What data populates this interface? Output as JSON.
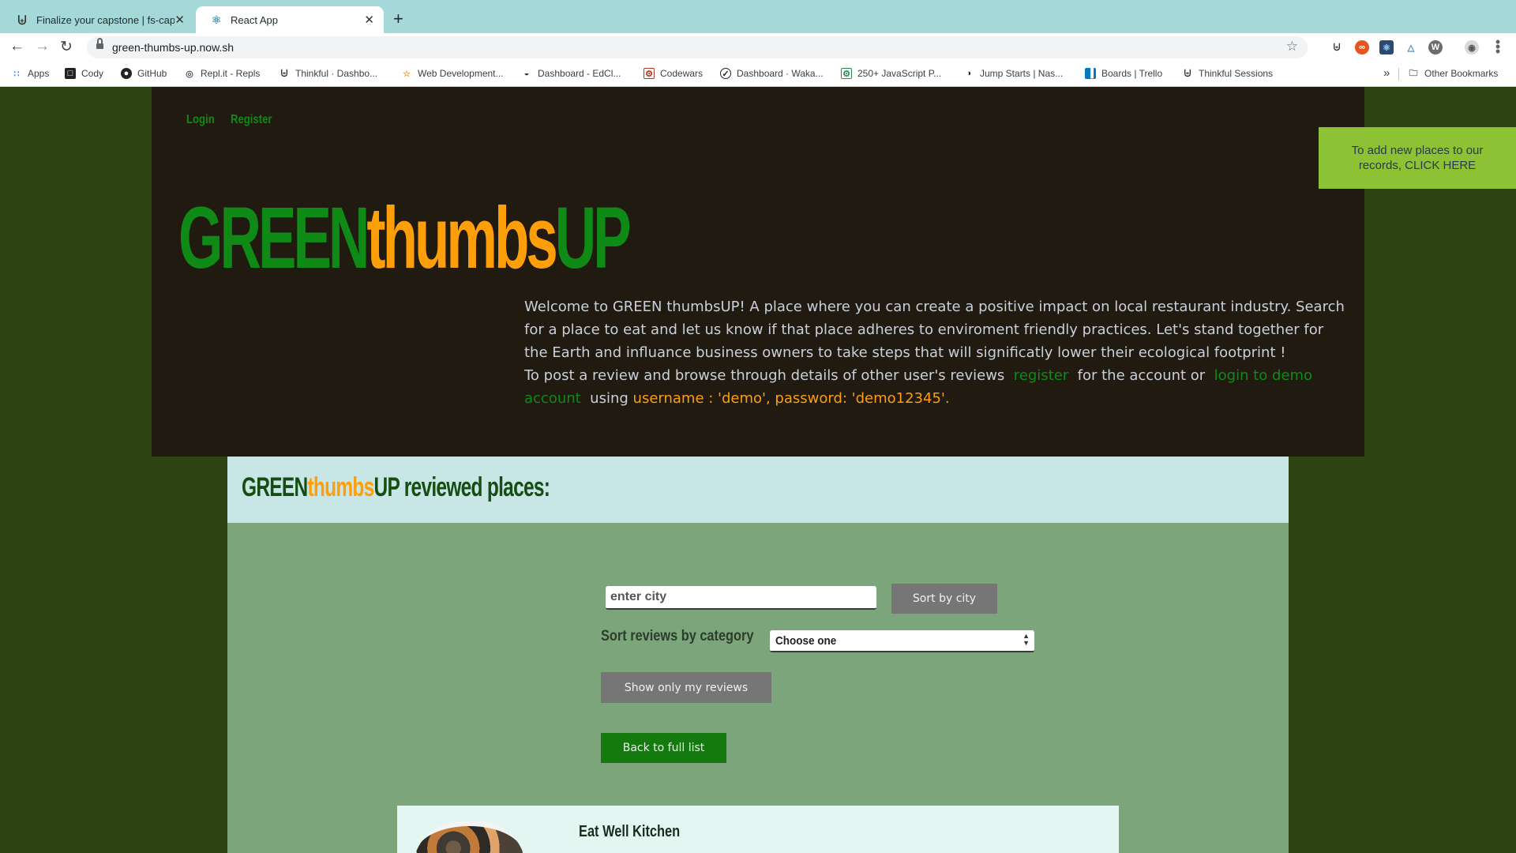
{
  "browser": {
    "tabs": [
      {
        "label": "Finalize your capstone | fs-capstone",
        "icon": "thinkful-icon",
        "active": false
      },
      {
        "label": "React App",
        "icon": "react-icon",
        "active": true
      }
    ],
    "url": "green-thumbs-up.now.sh",
    "bookmarks": [
      {
        "label": "Apps",
        "icon": "apps-grid-icon"
      },
      {
        "label": "Cody",
        "icon": "cody-icon"
      },
      {
        "label": "GitHub",
        "icon": "github-icon"
      },
      {
        "label": "Repl.it - Repls",
        "icon": "replit-icon"
      },
      {
        "label": "Thinkful · Dashbo...",
        "icon": "thinkful-icon"
      },
      {
        "label": "Web Development...",
        "icon": "web-dev-icon"
      },
      {
        "label": "Dashboard - EdCl...",
        "icon": "edclub-icon"
      },
      {
        "label": "Codewars",
        "icon": "codewars-icon"
      },
      {
        "label": "Dashboard · Waka...",
        "icon": "wakatime-icon"
      },
      {
        "label": "250+ JavaScript P...",
        "icon": "javascript-icon"
      },
      {
        "label": "Jump Starts | Nas...",
        "icon": "jumpstarts-icon"
      },
      {
        "label": "Boards | Trello",
        "icon": "trello-icon"
      },
      {
        "label": "Thinkful Sessions",
        "icon": "thinkful-icon"
      }
    ],
    "other_bookmarks": "Other Bookmarks"
  },
  "hero": {
    "nav": {
      "login": "Login",
      "register": "Register"
    },
    "brand": {
      "part1": "GREEN",
      "part2": "thumbs",
      "part3": "UP"
    },
    "welcome": "Welcome to GREEN thumbsUP! A place where you can create a positive impact on local restaurant industry. Search for a place to eat and let us know if that place adheres to enviroment friendly practices. Let's stand together for the Earth and influance business owners to take steps that will significatly lower their ecological footprint !",
    "post_prefix": "To post a review and browse through details of other user's reviews",
    "register_link": "register",
    "account_text": "for the account or",
    "login_demo_link": "login to demo account",
    "using_text": "using",
    "credentials": "username : 'demo', password: 'demo12345'."
  },
  "cta": {
    "text": "To add new places to our records, CLICK HERE"
  },
  "places": {
    "title_part1": "GREEN",
    "title_part2": "thumbs",
    "title_part3": "UP reviewed places:",
    "city_placeholder": "enter city",
    "sort_city_label": "Sort by city",
    "category_label": "Sort reviews by category",
    "category_selected": "Choose one",
    "my_reviews_label": "Show only my reviews",
    "back_label": "Back to full list"
  },
  "cards": [
    {
      "title": "Eat Well Kitchen"
    }
  ],
  "colors": {
    "brand_green": "#0f8a16",
    "brand_orange": "#fe9e09",
    "page_bg": "#2d4312",
    "hero_bg": "#211a10",
    "cta_bg": "#8cc233"
  }
}
